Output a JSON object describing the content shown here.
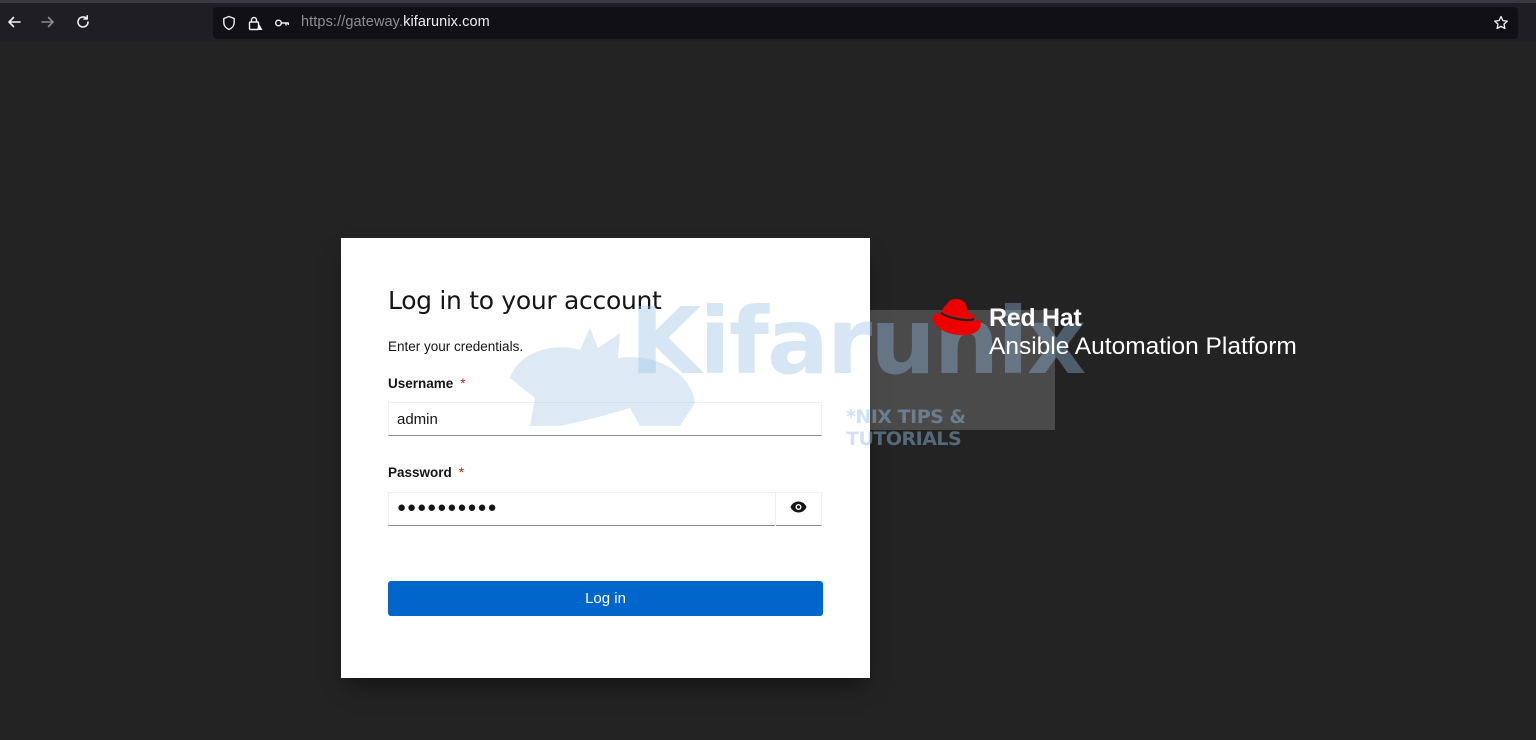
{
  "browser": {
    "url_prefix": "https://gateway.",
    "url_host": "kifarunix.com",
    "icons": [
      "back-arrow-icon",
      "forward-arrow-icon",
      "reload-icon",
      "shield-icon",
      "lock-warning-icon",
      "key-icon",
      "bookmark-star-icon"
    ]
  },
  "login": {
    "title": "Log in to your account",
    "subtitle": "Enter your credentials.",
    "username_label": "Username",
    "password_label": "Password",
    "required_marker": "*",
    "username_value": "admin",
    "password_masked": "●●●●●●●●●●",
    "submit_label": "Log in"
  },
  "watermark": {
    "brand": "Kifarunix",
    "tagline": "*NIX TIPS & TUTORIALS"
  },
  "brand": {
    "line1": "Red Hat",
    "line2": "Ansible Automation Platform",
    "hat_color": "#ee0000"
  },
  "colors": {
    "page_bg": "#232323",
    "primary_button": "#0066cc",
    "required": "#c9190b"
  }
}
